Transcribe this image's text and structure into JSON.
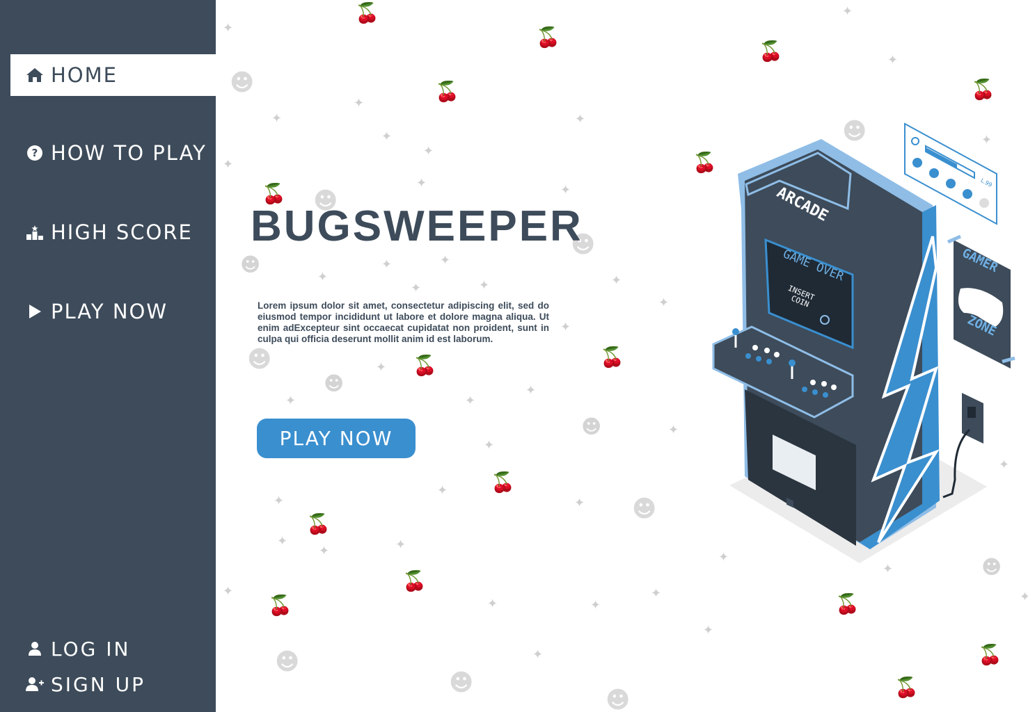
{
  "sidebar": {
    "items": [
      {
        "label": "HOME",
        "icon": "home-icon",
        "active": true
      },
      {
        "label": "HOW TO PLAY",
        "icon": "question-circle-icon",
        "active": false
      },
      {
        "label": "HIGH SCORE",
        "icon": "podium-icon",
        "active": false
      },
      {
        "label": "PLAY NOW",
        "icon": "play-icon",
        "active": false
      }
    ],
    "account": [
      {
        "label": "LOG IN",
        "icon": "user-icon"
      },
      {
        "label": "SIGN UP",
        "icon": "user-plus-icon"
      }
    ]
  },
  "main": {
    "title": "BUGSWEEPER",
    "description": "Lorem ipsum dolor sit amet, consectetur adipiscing elit, sed do eiusmod tempor incididunt ut labore et dolore magna aliqua. Ut enim adExcepteur sint occaecat cupidatat non proident, sunt in culpa qui officia deserunt mollit anim id est laborum.",
    "cta_label": "PLAY NOW"
  },
  "illustration": {
    "marquee": "ARCADE",
    "screen_line1": "GAME OVER",
    "screen_line2": "INSERT",
    "screen_line3": "COIN",
    "poster_top": "GAMER",
    "poster_bottom": "ZONE",
    "level_text": "L.99"
  },
  "colors": {
    "sidebar_bg": "#3d4b5a",
    "accent_blue": "#3a8fcf",
    "text_dark": "#3d4b5a",
    "pattern_gray": "#cfcfcf"
  }
}
